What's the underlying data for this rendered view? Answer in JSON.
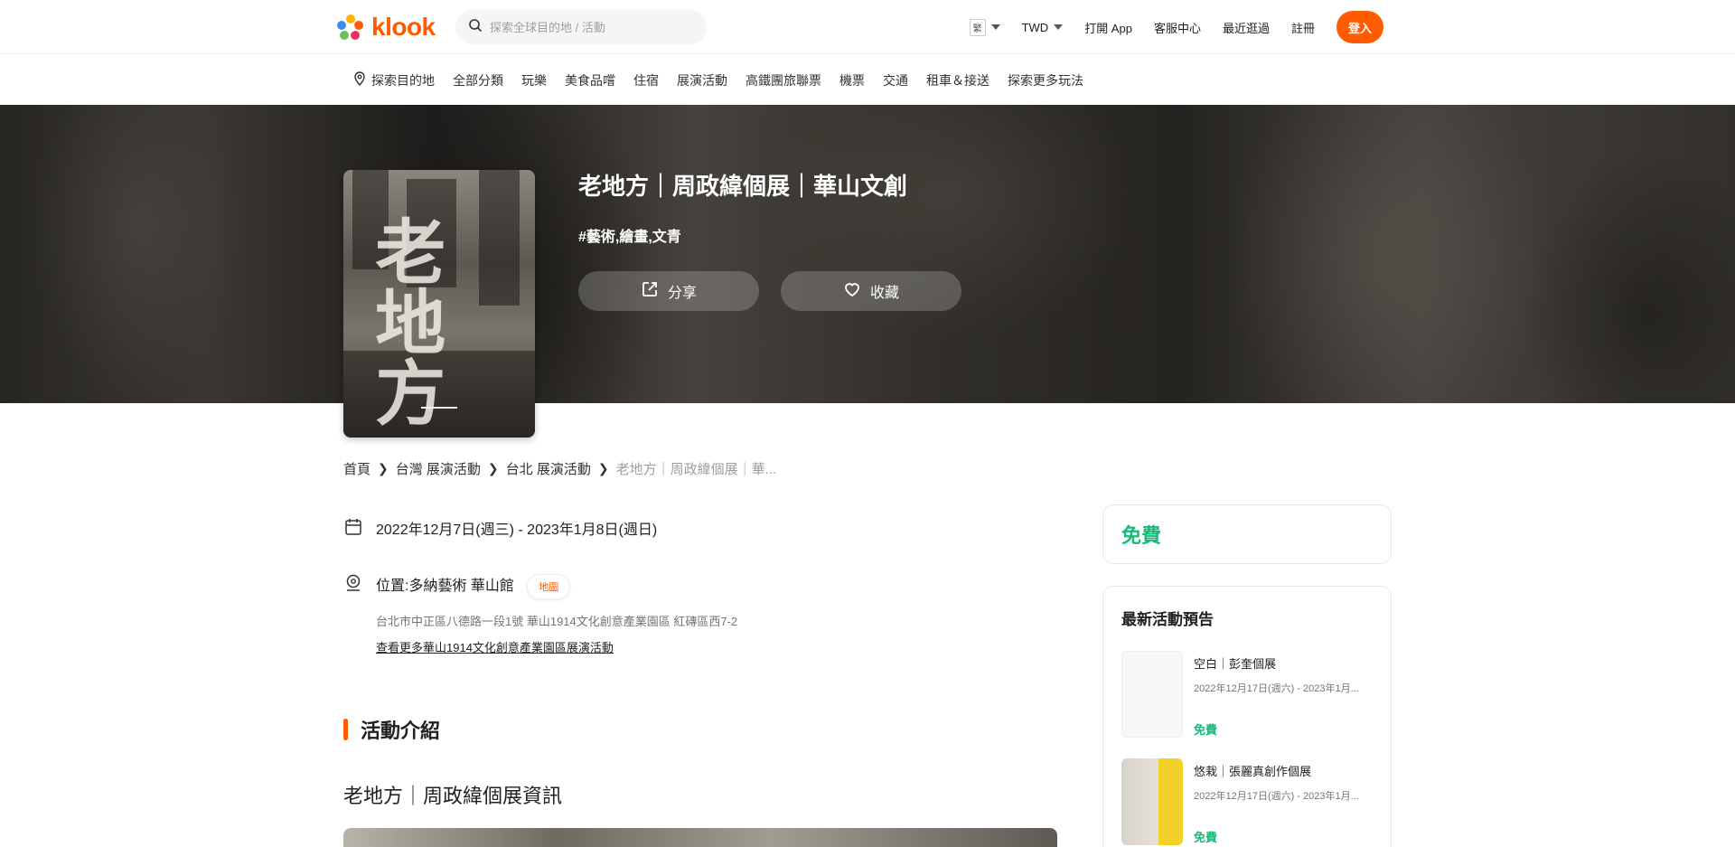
{
  "header": {
    "logo_text": "klook",
    "search_placeholder": "探索全球目的地 / 活動",
    "lang": "繁",
    "currency": "TWD",
    "open_app": "打開 App",
    "support": "客服中心",
    "recent": "最近逛過",
    "register": "註冊",
    "login": "登入"
  },
  "nav": {
    "items": [
      "探索目的地",
      "全部分類",
      "玩樂",
      "美食品嚐",
      "住宿",
      "展演活動",
      "高鐵團旅聯票",
      "機票",
      "交通",
      "租車＆接送",
      "探索更多玩法"
    ]
  },
  "hero": {
    "title": "老地方｜周政緯個展｜華山文創",
    "tags": "#藝術,繪畫,文青",
    "share_label": "分享",
    "favorite_label": "收藏",
    "poster_text": "老地方"
  },
  "breadcrumb": {
    "items": [
      "首頁",
      "台灣 展演活動",
      "台北 展演活動"
    ],
    "current": "老地方｜周政緯個展｜華..."
  },
  "info": {
    "date": "2022年12月7日(週三) - 2023年1月8日(週日)",
    "location": "位置:多納藝術 華山館",
    "map_label": "地圖",
    "address": "台北市中正區八德路一段1號 華山1914文化創意產業園區 紅磚區西7-2",
    "more_link": "查看更多華山1914文化創意產業園區展演活動"
  },
  "section": {
    "title": "活動介紹",
    "subtitle": "老地方｜周政緯個展資訊"
  },
  "sidebar": {
    "price": "免費",
    "upcoming_title": "最新活動預告",
    "upcoming": [
      {
        "title": "空白｜彭奎個展",
        "date": "2022年12月17日(週六) - 2023年1月...",
        "price": "免費"
      },
      {
        "title": "悠栽｜張麗真創作個展",
        "date": "2022年12月17日(週六) - 2023年1月...",
        "price": "免費"
      }
    ]
  },
  "colors": {
    "brand": "#ff5b00",
    "free": "#16b978"
  }
}
